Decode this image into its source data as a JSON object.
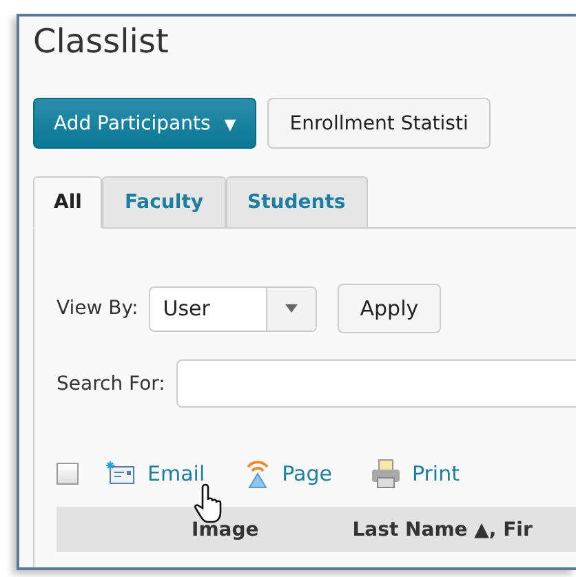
{
  "title": "Classlist",
  "buttons": [
    {
      "label": "Add Participants",
      "kind": "primary",
      "caret": "▼"
    },
    {
      "label": "Enrollment Statisti",
      "kind": "secondary"
    }
  ],
  "tabs": [
    {
      "label": "All",
      "selected": true
    },
    {
      "label": "Faculty",
      "selected": false
    },
    {
      "label": "Students",
      "selected": false
    }
  ],
  "view_by": {
    "label": "View By:",
    "value": "User",
    "apply": "Apply"
  },
  "search": {
    "label": "Search For:"
  },
  "select_all": {
    "checked": false
  },
  "actions": [
    {
      "label": "Email",
      "kind": "email"
    },
    {
      "label": "Page",
      "kind": "page"
    },
    {
      "label": "Print",
      "kind": "print"
    }
  ],
  "columns": [
    {
      "label": "Image"
    },
    {
      "label": "Last Name ▲, Fir"
    }
  ]
}
